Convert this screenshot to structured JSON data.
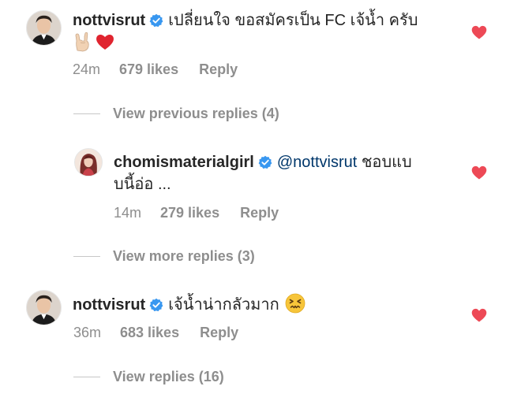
{
  "comments": [
    {
      "username": "nottvisrut",
      "text_line1": "เปลี่ยนใจ ขอสมัครเป็น FC เจ้น้ำ ครับ",
      "emojis": [
        "rock-on-hand-emoji",
        "red-heart-emoji"
      ],
      "time": "24m",
      "likes": "679 likes",
      "reply": "Reply"
    },
    {
      "username": "chomismaterialgirl",
      "mention": "@nottvisrut",
      "text_line1": " ชอบแบ",
      "text_line2": "บนี้อ่อ ...",
      "time": "14m",
      "likes": "279 likes",
      "reply": "Reply"
    },
    {
      "username": "nottvisrut",
      "text_line1": "เจ้น้ำน่ากลัวมาก",
      "emojis": [
        "confounded-face-emoji"
      ],
      "time": "36m",
      "likes": "683 likes",
      "reply": "Reply"
    }
  ],
  "links": {
    "view_previous": "View previous replies (4)",
    "view_more": "View more replies (3)",
    "view_replies": "View replies (16)"
  },
  "colors": {
    "heart": "#ed4956",
    "verified": "#3897f0",
    "meta_text": "#8e8e8e",
    "mention": "#00376b"
  }
}
